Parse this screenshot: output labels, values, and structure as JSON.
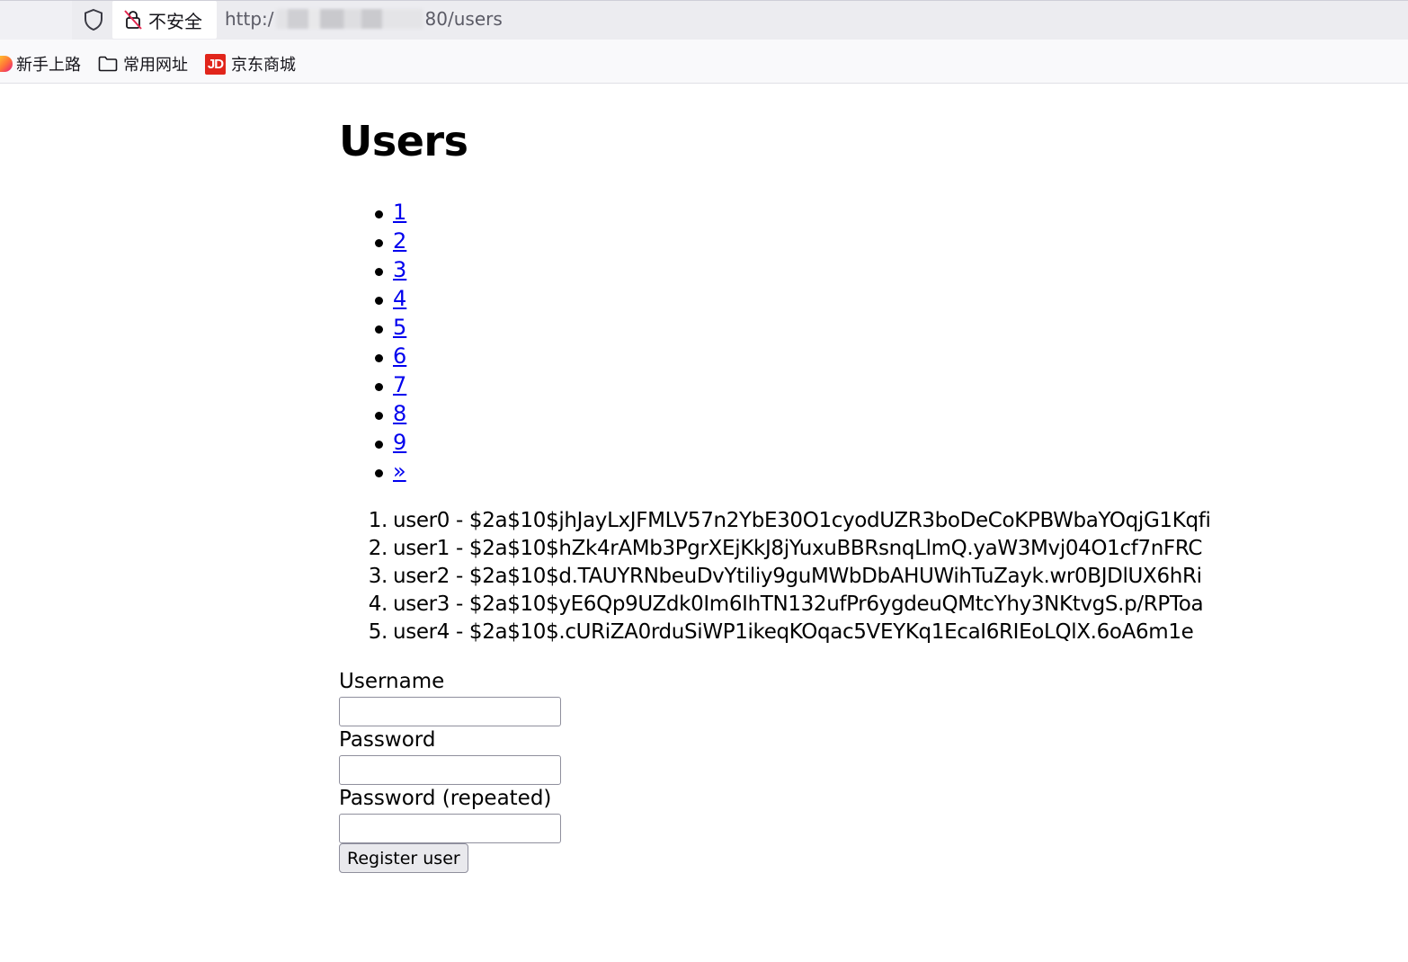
{
  "browser": {
    "security_label": "不安全",
    "url_prefix": "http:/",
    "url_suffix": "80/users",
    "bookmarks": [
      {
        "label": "新手上路",
        "icon": "firefox-icon"
      },
      {
        "label": "常用网址",
        "icon": "folder-icon"
      },
      {
        "label": "京东商城",
        "icon": "jd-logo-icon",
        "logo_text": "JD"
      }
    ]
  },
  "page": {
    "title": "Users",
    "pagination": [
      "1",
      "2",
      "3",
      "4",
      "5",
      "6",
      "7",
      "8",
      "9",
      "»"
    ],
    "users": [
      {
        "num": "1.",
        "text": "user0 - $2a$10$jhJayLxJFMLV57n2YbE30O1cyodUZR3boDeCoKPBWbaYOqjG1Kqfi"
      },
      {
        "num": "2.",
        "text": "user1 - $2a$10$hZk4rAMb3PgrXEjKkJ8jYuxuBBRsnqLlmQ.yaW3Mvj04O1cf7nFRC"
      },
      {
        "num": "3.",
        "text": "user2 - $2a$10$d.TAUYRNbeuDvYtiliy9guMWbDbAHUWihTuZayk.wr0BJDlUX6hRi"
      },
      {
        "num": "4.",
        "text": "user3 - $2a$10$yE6Qp9UZdk0Im6IhTN132ufPr6ygdeuQMtcYhy3NKtvgS.p/RPToa"
      },
      {
        "num": "5.",
        "text": "user4 - $2a$10$.cURiZA0rduSiWP1ikeqKOqac5VEYKq1EcaI6RIEoLQlX.6oA6m1e"
      }
    ],
    "form": {
      "username_label": "Username",
      "username_value": "",
      "password_label": "Password",
      "password_value": "",
      "password_repeat_label": "Password (repeated)",
      "password_repeat_value": "",
      "submit_label": "Register user"
    }
  },
  "colors": {
    "link": "#0000ee",
    "jd_brand": "#e1251b"
  }
}
